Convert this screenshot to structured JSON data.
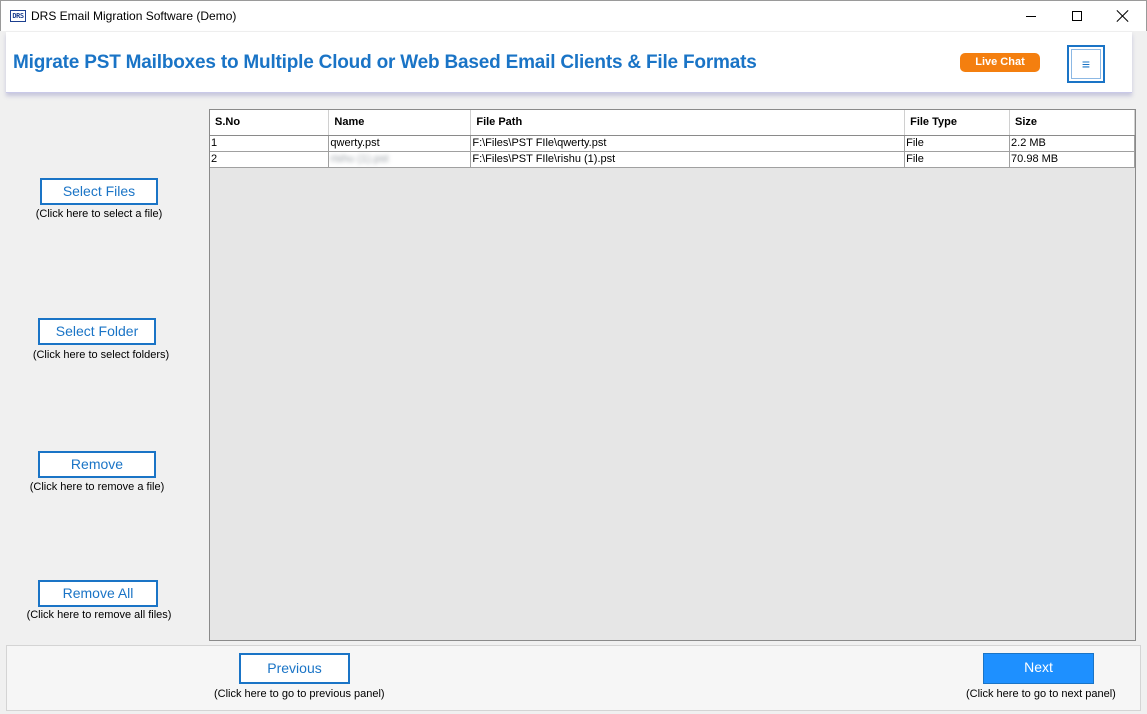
{
  "window": {
    "icon_text": "DRS",
    "title": "DRS Email Migration Software (Demo)"
  },
  "banner": {
    "title": "Migrate PST Mailboxes to Multiple Cloud or Web Based Email Clients & File Formats",
    "live_chat": "Live Chat",
    "menu_glyph": "≡"
  },
  "sidebar": {
    "select_files": {
      "label": "Select Files",
      "hint": "(Click here to select a file)"
    },
    "select_folder": {
      "label": "Select Folder",
      "hint": "(Click here to select folders)"
    },
    "remove": {
      "label": "Remove",
      "hint": "(Click here to remove a file)"
    },
    "remove_all": {
      "label": "Remove All",
      "hint": "(Click here to remove all files)"
    }
  },
  "table": {
    "columns": [
      "S.No",
      "Name",
      "File Path",
      "File Type",
      "Size"
    ],
    "rows": [
      {
        "sno": "1",
        "name": "qwerty.pst",
        "path": "F:\\Files\\PST FIle\\qwerty.pst",
        "type": "File",
        "size": "2.2 MB"
      },
      {
        "sno": "2",
        "name": "rishu (1).pst",
        "path": "F:\\Files\\PST FIle\\rishu (1).pst",
        "type": "File",
        "size": "70.98 MB"
      }
    ]
  },
  "footer": {
    "previous": {
      "label": "Previous",
      "hint": "(Click here to go to previous panel)"
    },
    "next": {
      "label": "Next",
      "hint": "(Click here to go to next panel)"
    }
  },
  "colors": {
    "accent": "#1a74c6",
    "live_chat": "#f47f0f",
    "next_button": "#1e90ff"
  }
}
